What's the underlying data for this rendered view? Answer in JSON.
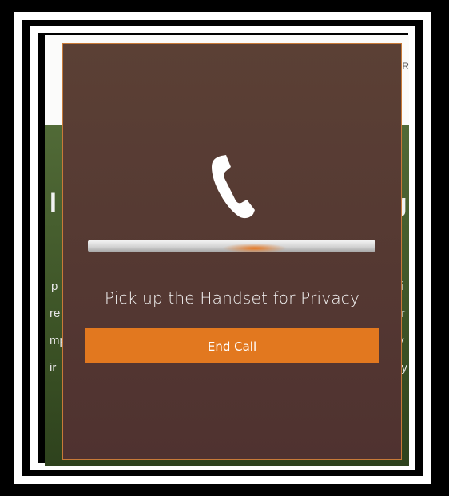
{
  "background_page": {
    "header_fragment": "AR",
    "heading_left_fragment": "l",
    "heading_right_fragment": "g",
    "left_fragments": [
      "p",
      "re",
      "mp",
      "ir"
    ],
    "right_fragments": [
      "ui",
      "ar",
      "y",
      "ey"
    ]
  },
  "dialog": {
    "icon": "phone-handset-icon",
    "progress_indicator": "indeterminate",
    "status_text": "Pick up the Handset for Privacy",
    "end_call_label": "End Call"
  },
  "colors": {
    "dialog_background": "#553a32",
    "accent": "#e2781f",
    "frame": "#ffffff",
    "page_green": "#4a6330"
  }
}
